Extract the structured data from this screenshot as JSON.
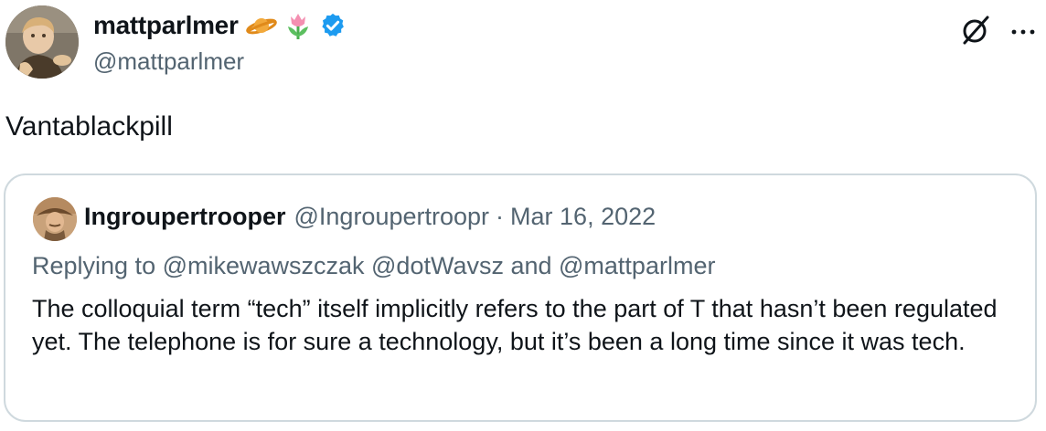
{
  "author": {
    "display_name": "mattparlmer",
    "handle": "@mattparlmer",
    "badges": [
      "ringed-planet-icon",
      "tulip-icon",
      "verified-badge-icon"
    ],
    "verified_color": "#1d9bf0"
  },
  "tweet": {
    "text": "Vantablackpill"
  },
  "quoted_tweet": {
    "display_name": "Ingroupertrooper",
    "handle": "@Ingroupertroopr",
    "separator": "·",
    "date": "Mar 16, 2022",
    "replying_to": "Replying to @mikewawszczak @dotWavsz and @mattparlmer",
    "text": "The colloquial term “tech” itself implicitly refers to the part of T that hasn’t been regulated yet.  The telephone is for sure a technology, but it’s been a long time since it was tech."
  },
  "icons": {
    "grok": "slashed-circle-icon",
    "more": "more-dots-icon"
  },
  "colors": {
    "text": "#0f1419",
    "secondary": "#536471",
    "border": "#cfd9de"
  }
}
